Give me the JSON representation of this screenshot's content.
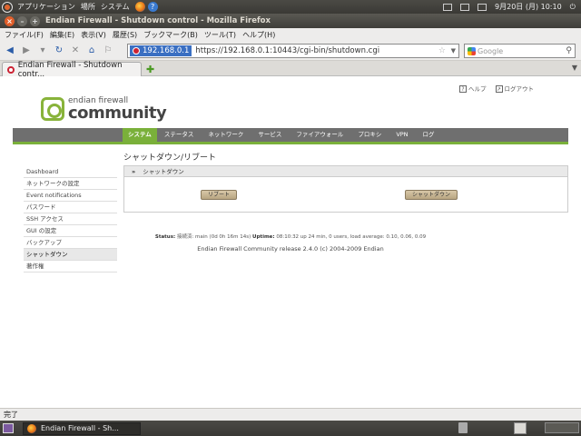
{
  "panel": {
    "menus": [
      "アプリケーション",
      "場所",
      "システム"
    ],
    "clock": "9月20日 (月) 10:10"
  },
  "window": {
    "title": "Endian Firewall - Shutdown control - Mozilla Firefox"
  },
  "menubar": {
    "items": [
      "ファイル(F)",
      "編集(E)",
      "表示(V)",
      "履歴(S)",
      "ブックマーク(B)",
      "ツール(T)",
      "ヘルプ(H)"
    ]
  },
  "navbar": {
    "url_host": "192.168.0.1",
    "url": "https://192.168.0.1:10443/cgi-bin/shutdown.cgi",
    "search_placeholder": "Google"
  },
  "tabs": [
    {
      "label": "Endian Firewall - Shutdown contr..."
    }
  ],
  "header": {
    "help": "ヘルプ",
    "logout": "ログアウト",
    "logo_small": "endian firewall",
    "logo_big": "community"
  },
  "main_nav": [
    "システム",
    "ステータス",
    "ネットワーク",
    "サービス",
    "ファイアウォール",
    "プロキシ",
    "VPN",
    "ログ"
  ],
  "page_title": "シャットダウン/リブート",
  "sidebar": [
    "Dashboard",
    "ネットワークの設定",
    "Event notifications",
    "パスワード",
    "SSH アクセス",
    "GUI の設定",
    "バックアップ",
    "シャットダウン",
    "著作権"
  ],
  "panel_box": {
    "marker": "»",
    "header": "シャットダウン",
    "reboot_label": "リブート",
    "shutdown_label": "シャットダウン"
  },
  "footer": {
    "status_label": "Status:",
    "status_text": "接続済: main (0d 0h 16m 14s)",
    "uptime_label": "Uptime:",
    "uptime_text": "08:10:32 up 24 min, 0 users, load average: 0.10, 0.06, 0.09",
    "copyright": "Endian Firewall Community release 2.4.0 (c) 2004-2009 Endian"
  },
  "statusbar": {
    "text": "完了"
  },
  "taskbar": {
    "task_label": "Endian Firewall - Sh..."
  }
}
